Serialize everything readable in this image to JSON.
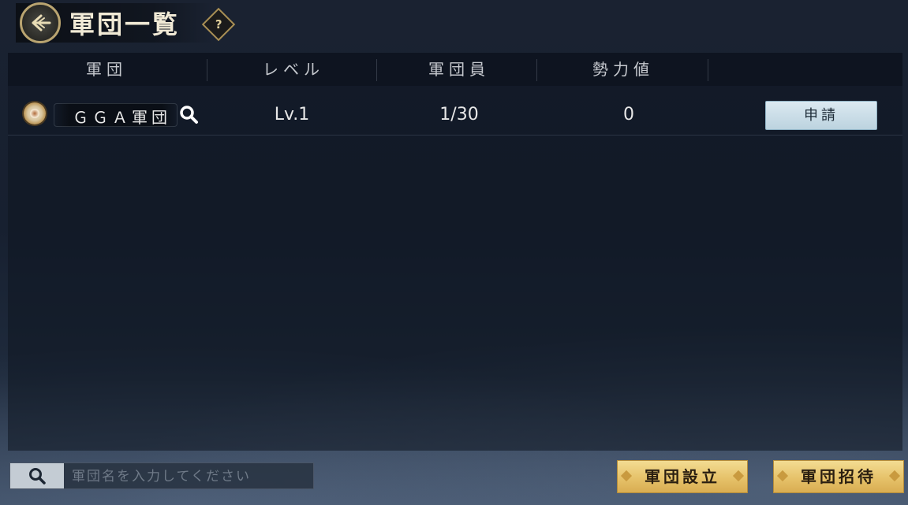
{
  "header": {
    "title": "軍団一覧",
    "help_label": "?"
  },
  "table": {
    "columns": [
      "軍団",
      "レベル",
      "軍団員",
      "勢力値"
    ],
    "rows": [
      {
        "name": "ＧＧＡ軍団",
        "level": "Lv.1",
        "members": "1/30",
        "power": "0",
        "action_label": "申請"
      }
    ]
  },
  "footer": {
    "search_placeholder": "軍団名を入力してください",
    "create_label": "軍団設立",
    "invite_label": "軍団招待"
  },
  "colors": {
    "accent_gold": "#e6c26a",
    "apply_blue": "#c9dce6",
    "background": "#172030"
  },
  "icons": [
    "back-arrow-icon",
    "help-icon",
    "guild-emblem-icon",
    "magnifier-icon",
    "search-icon"
  ]
}
